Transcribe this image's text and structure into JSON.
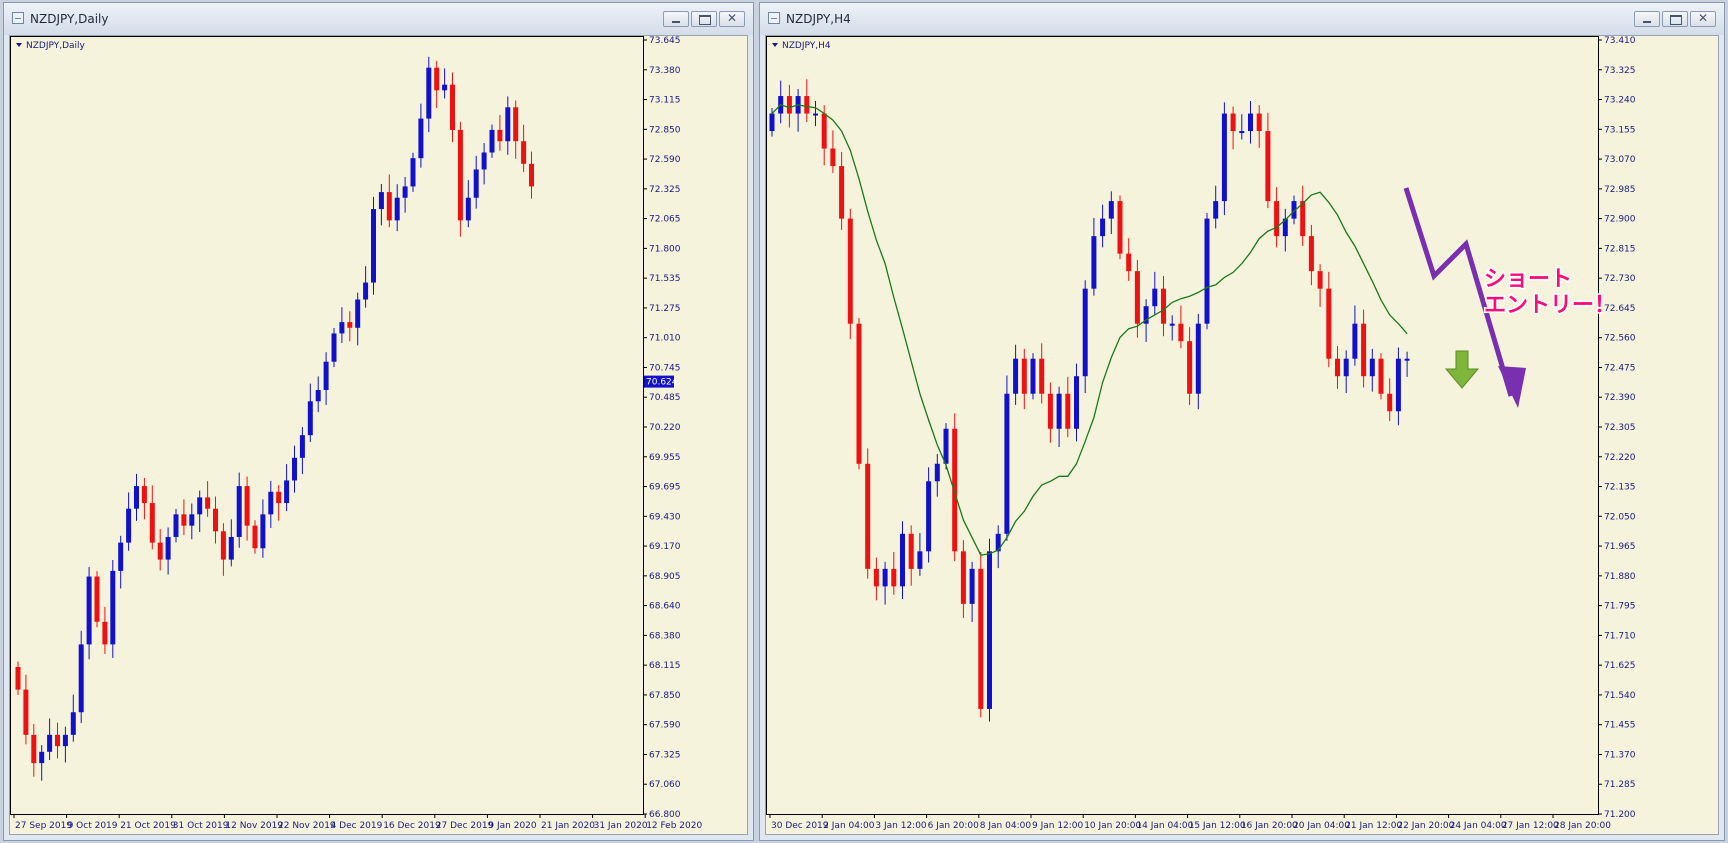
{
  "windows": [
    {
      "id": "daily",
      "title": "NZDJPY,Daily",
      "chart_label": "NZDJPY,Daily",
      "bid": "70.624",
      "colors": {
        "up": "#1111cc",
        "down": "#ee1111",
        "bg": "#f6f3dd",
        "bid_tag": "#1111cc"
      },
      "chart_data": {
        "type": "candlestick",
        "symbol": "NZDJPY",
        "timeframe": "Daily",
        "ylim": [
          66.8,
          73.645
        ],
        "y_ticks": [
          "73.645",
          "73.380",
          "73.115",
          "72.850",
          "72.590",
          "72.325",
          "72.065",
          "71.800",
          "71.535",
          "71.275",
          "71.010",
          "70.745",
          "70.485",
          "70.220",
          "69.955",
          "69.695",
          "69.430",
          "69.170",
          "68.905",
          "68.640",
          "68.380",
          "68.115",
          "67.850",
          "67.590",
          "67.325",
          "67.060",
          "66.800"
        ],
        "x_ticks": [
          "27 Sep 2019",
          "9 Oct 2019",
          "21 Oct 2019",
          "31 Oct 2019",
          "12 Nov 2019",
          "22 Nov 2019",
          "4 Dec 2019",
          "16 Dec 2019",
          "27 Dec 2019",
          "9 Jan 2020",
          "21 Jan 2020",
          "31 Jan 2020",
          "12 Feb 2020"
        ],
        "close": [
          67.9,
          67.5,
          67.25,
          67.35,
          67.5,
          67.4,
          67.5,
          67.7,
          68.3,
          68.9,
          68.5,
          68.3,
          68.95,
          69.2,
          69.5,
          69.7,
          69.55,
          69.2,
          69.05,
          69.25,
          69.45,
          69.35,
          69.45,
          69.6,
          69.5,
          69.3,
          69.05,
          69.25,
          69.7,
          69.35,
          69.15,
          69.45,
          69.65,
          69.55,
          69.75,
          69.95,
          70.15,
          70.45,
          70.55,
          70.8,
          71.05,
          71.15,
          71.1,
          71.35,
          71.5,
          72.15,
          72.3,
          72.05,
          72.25,
          72.35,
          72.6,
          72.95,
          73.4,
          73.2,
          73.25,
          72.85,
          72.05,
          72.25,
          72.5,
          72.65,
          72.85,
          72.75,
          73.05,
          72.75,
          72.55,
          72.35
        ],
        "annotations": []
      }
    },
    {
      "id": "h4",
      "title": "NZDJPY,H4",
      "chart_label": "NZDJPY,H4",
      "colors": {
        "up": "#1111cc",
        "down": "#ee1111",
        "ma": "#1a7a1a",
        "bg": "#f6f3dd",
        "arrow": "#7a2fb0",
        "callout": "#ff0a78",
        "green_arrow": "#7fb53a"
      },
      "callout_text": [
        "ショート",
        "エントリー！"
      ],
      "chart_data": {
        "type": "candlestick",
        "symbol": "NZDJPY",
        "timeframe": "H4",
        "ylim": [
          71.2,
          73.41
        ],
        "y_ticks": [
          "73.410",
          "73.325",
          "73.240",
          "73.155",
          "73.070",
          "72.985",
          "72.900",
          "72.815",
          "72.730",
          "72.645",
          "72.560",
          "72.475",
          "72.390",
          "72.305",
          "72.220",
          "72.135",
          "72.050",
          "71.965",
          "71.880",
          "71.795",
          "71.710",
          "71.625",
          "71.540",
          "71.455",
          "71.370",
          "71.285",
          "71.200"
        ],
        "x_ticks": [
          "30 Dec 2019",
          "2 Jan 04:00",
          "3 Jan 12:00",
          "6 Jan 20:00",
          "8 Jan 04:00",
          "9 Jan 12:00",
          "10 Jan 20:00",
          "14 Jan 04:00",
          "15 Jan 12:00",
          "16 Jan 20:00",
          "20 Jan 04:00",
          "21 Jan 12:00",
          "22 Jan 20:00",
          "24 Jan 04:00",
          "27 Jan 12:00",
          "28 Jan 20:00"
        ],
        "close": [
          73.2,
          73.25,
          73.2,
          73.25,
          73.2,
          73.2,
          73.1,
          73.05,
          72.9,
          72.6,
          72.2,
          71.9,
          71.85,
          71.9,
          71.85,
          72.0,
          71.9,
          71.95,
          72.15,
          72.2,
          72.3,
          71.95,
          71.8,
          71.9,
          71.5,
          71.95,
          72.0,
          72.4,
          72.5,
          72.4,
          72.5,
          72.4,
          72.3,
          72.4,
          72.3,
          72.45,
          72.7,
          72.85,
          72.9,
          72.95,
          72.8,
          72.75,
          72.6,
          72.65,
          72.7,
          72.6,
          72.6,
          72.55,
          72.4,
          72.6,
          72.9,
          72.95,
          73.2,
          73.15,
          73.15,
          73.2,
          73.15,
          72.95,
          72.85,
          72.9,
          72.95,
          72.85,
          72.75,
          72.7,
          72.5,
          72.45,
          72.5,
          72.6,
          72.45,
          72.5,
          72.4,
          72.35,
          72.5,
          72.5
        ],
        "ma_period_note": "",
        "annotations": [
          "ショート",
          "エントリー！"
        ]
      }
    }
  ]
}
